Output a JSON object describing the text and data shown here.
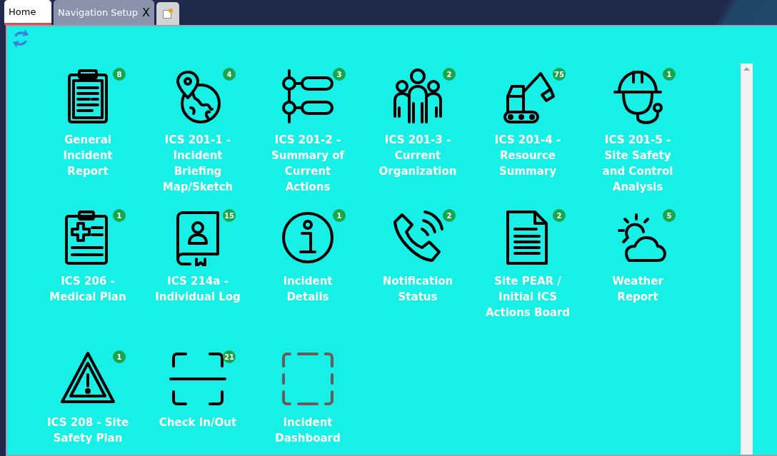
{
  "tabs": [
    {
      "label": "Home",
      "selected": true
    },
    {
      "label": "Navigation Setup",
      "selected": false,
      "close": "X"
    }
  ],
  "tiles": [
    {
      "kind": "clipboard",
      "badge": "8",
      "label": "General Incident Report"
    },
    {
      "kind": "globe",
      "badge": "4",
      "label": "ICS 201-1 - Incident Briefing Map/Sketch"
    },
    {
      "kind": "flow",
      "badge": "3",
      "label": "ICS 201-2 - Summary of Current Actions"
    },
    {
      "kind": "people",
      "badge": "2",
      "label": "ICS 201-3 - Current Organization"
    },
    {
      "kind": "excavator",
      "badge": "75",
      "label": "ICS 201-4 - Resource Summary"
    },
    {
      "kind": "hardhat",
      "badge": "1",
      "label": "ICS 201-5 - Site Safety and Control Analysis"
    },
    {
      "kind": "medical",
      "badge": "1",
      "label": "ICS 206 - Medical Plan"
    },
    {
      "kind": "book",
      "badge": "15",
      "label": "ICS 214a - Individual Log"
    },
    {
      "kind": "info",
      "badge": "1",
      "label": "Incident Details"
    },
    {
      "kind": "phone",
      "badge": "2",
      "label": "Notification Status"
    },
    {
      "kind": "document",
      "badge": "2",
      "label": "Site PEAR / Initial ICS Actions Board"
    },
    {
      "kind": "weather",
      "badge": "5",
      "label": "Weather Report"
    },
    {
      "kind": "warning",
      "badge": "1",
      "label": "ICS 208 - Site Safety Plan"
    },
    {
      "kind": "scan",
      "badge": "21",
      "label": "Check In/Out"
    },
    {
      "kind": "dashed",
      "label": "Incident Dashboard"
    }
  ]
}
